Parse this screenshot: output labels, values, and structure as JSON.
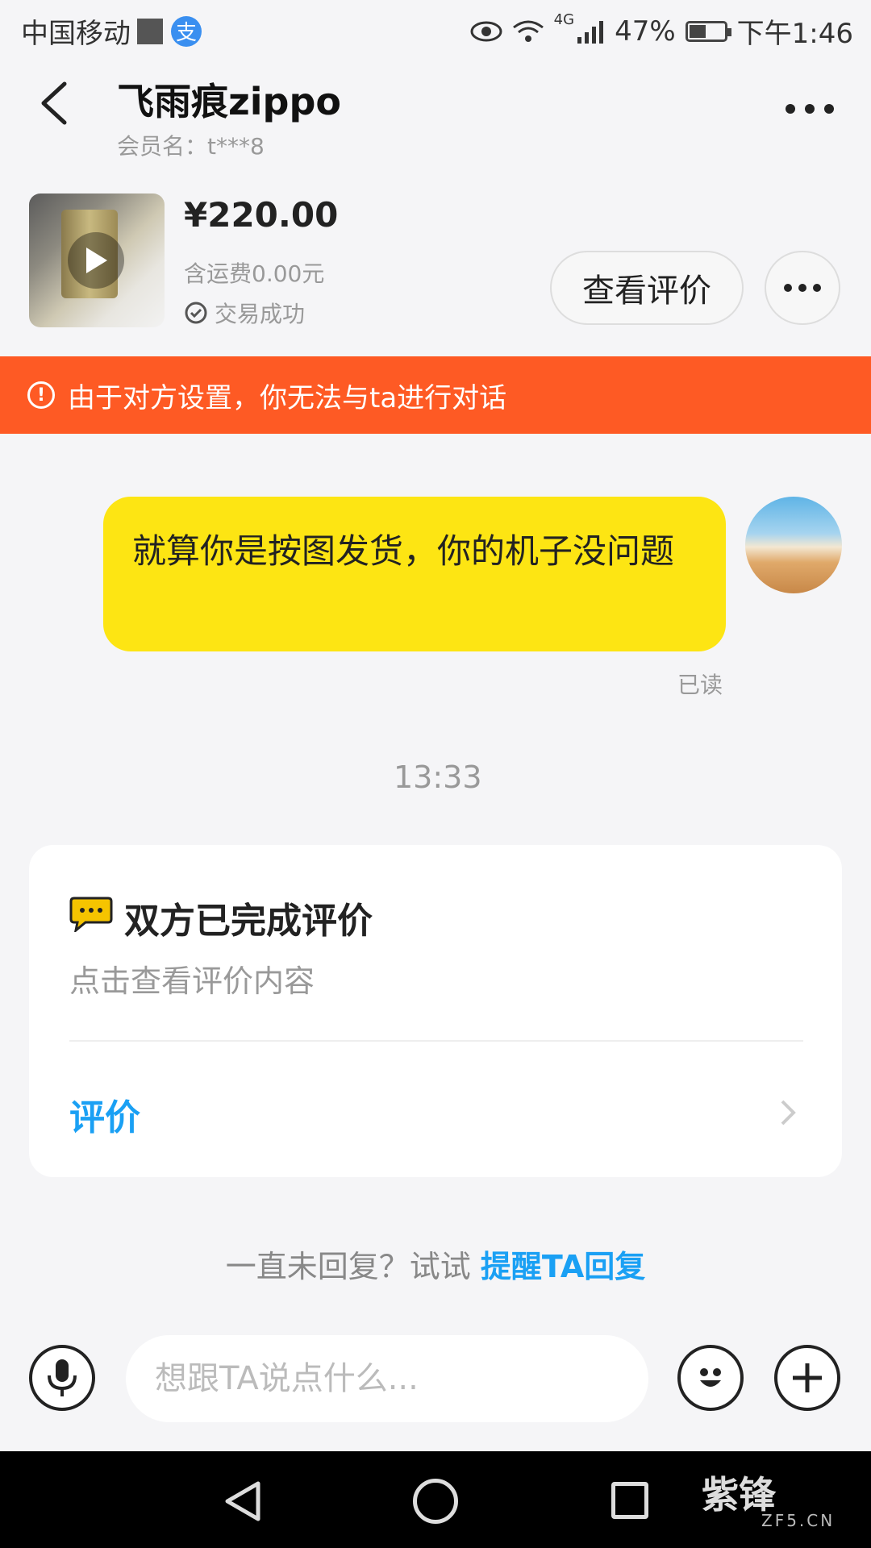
{
  "status_bar": {
    "carrier": "中国移动",
    "network": "4G",
    "battery_percent": "47%",
    "battery_level": 0.47,
    "time": "下午1:46"
  },
  "header": {
    "contact_name": "飞雨痕zippo",
    "member_name": "会员名：t***8"
  },
  "product": {
    "price": "¥220.00",
    "shipping": "含运费0.00元",
    "trade_status": "交易成功",
    "review_button": "查看评价"
  },
  "banner": {
    "text": "由于对方设置，你无法与ta进行对话",
    "color": "#fe5a24"
  },
  "messages": [
    {
      "text": "就算你是按图发货，你的机子没问题",
      "read_status": "已读",
      "bubble_color": "#fde513"
    }
  ],
  "time_divider": "13:33",
  "review_card": {
    "title": "双方已完成评价",
    "subtitle": "点击查看评价内容",
    "link": "评价"
  },
  "remind": {
    "prefix": "一直未回复？试试",
    "link": "提醒TA回复"
  },
  "input": {
    "placeholder": "想跟TA说点什么..."
  },
  "watermark": {
    "brand": "紫锋",
    "domain": "ZF5.CN"
  },
  "icons": [
    "back-arrow-icon",
    "more-icon",
    "play-icon",
    "check-circle-icon",
    "warning-icon",
    "chat-bubble-icon",
    "chevron-right-icon",
    "microphone-icon",
    "emoji-icon",
    "plus-icon"
  ],
  "accent_color": "#1aa0f4"
}
